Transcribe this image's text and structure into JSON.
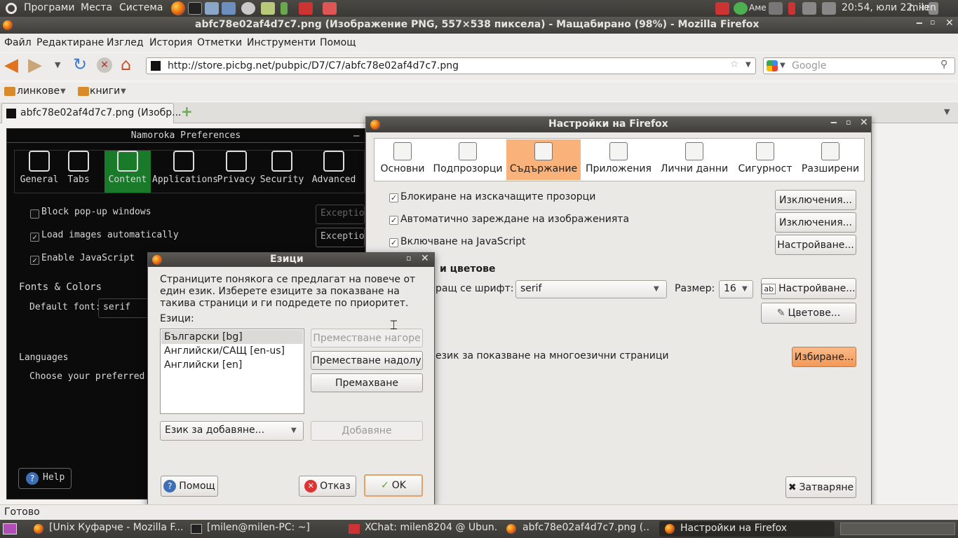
{
  "panel": {
    "menus": [
      "Програми",
      "Места",
      "Система"
    ],
    "weather": "Аме",
    "clock": "20:54, юли 22, чт",
    "user": "milen"
  },
  "firefox": {
    "title": "abfc78e02af4d7c7.png (Изображение PNG, 557×538 пиксела) - Мащабирано (98%) - Mozilla Firefox",
    "menu": [
      "Файл",
      "Редактиране",
      "Изглед",
      "История",
      "Отметки",
      "Инструменти",
      "Помощ"
    ],
    "url": "http://store.picbg.net/pubpic/D7/C7/abfc78e02af4d7c7.png",
    "search_placeholder": "Google",
    "bookmarks": [
      "линкове",
      "книги"
    ],
    "tab": "abfc78e02af4d7c7.png (Изобр...",
    "status": "Готово"
  },
  "namoroka": {
    "title": "Namoroka Preferences",
    "tabs": [
      "General",
      "Tabs",
      "Content",
      "Applications",
      "Privacy",
      "Security",
      "Advanced"
    ],
    "block_popups": "Block pop-up windows",
    "load_images": "Load images automatically",
    "enable_js": "Enable JavaScript",
    "exceptions": "Exceptions",
    "fonts_heading": "Fonts & Colors",
    "default_font_label": "Default font:",
    "default_font": "serif",
    "languages_heading": "Languages",
    "languages_text": "Choose your preferred la",
    "help": "Help"
  },
  "prefs": {
    "title": "Настройки на Firefox",
    "tabs": [
      "Основни",
      "Подпрозорци",
      "Съдържание",
      "Приложения",
      "Лични данни",
      "Сигурност",
      "Разширени"
    ],
    "block_popups": "Блокиране на изскачащите прозорци",
    "load_images": "Автоматично зареждане на изображенията",
    "enable_js": "Включване на JavaScript",
    "exceptions": "Изключения...",
    "settings": "Настройване...",
    "fonts_heading": "и цветове",
    "default_font_label": "ращ се шрифт:",
    "font_value": "serif",
    "size_label": "Размер:",
    "size_value": "16",
    "advanced": "Настройване...",
    "colors": "Цветове...",
    "lang_text": "език за показване на многоезични страници",
    "choose": "Избиране...",
    "close": "Затваряне"
  },
  "lang_dialog": {
    "title": "Езици",
    "description": "Страниците понякога се предлагат на повече от един език. Изберете езиците за показване на такива страници и ги подредете по приоритет.",
    "list_label": "Езици:",
    "languages": [
      "Български  [bg]",
      "Английски/САЩ  [en-us]",
      "Английски  [en]"
    ],
    "move_up": "Преместване нагоре",
    "move_down": "Преместване надолу",
    "remove": "Премахване",
    "add_select": "Език за добавяне...",
    "add": "Добавяне",
    "help": "Помощ",
    "cancel": "Отказ",
    "ok": "OK"
  },
  "taskbar": {
    "items": [
      "[Unix Куфарче - Mozilla F...",
      "[milen@milen-PC: ~]",
      "XChat: milen8204 @ Ubun...",
      "abfc78e02af4d7c7.png (...",
      "Настройки на Firefox"
    ]
  }
}
